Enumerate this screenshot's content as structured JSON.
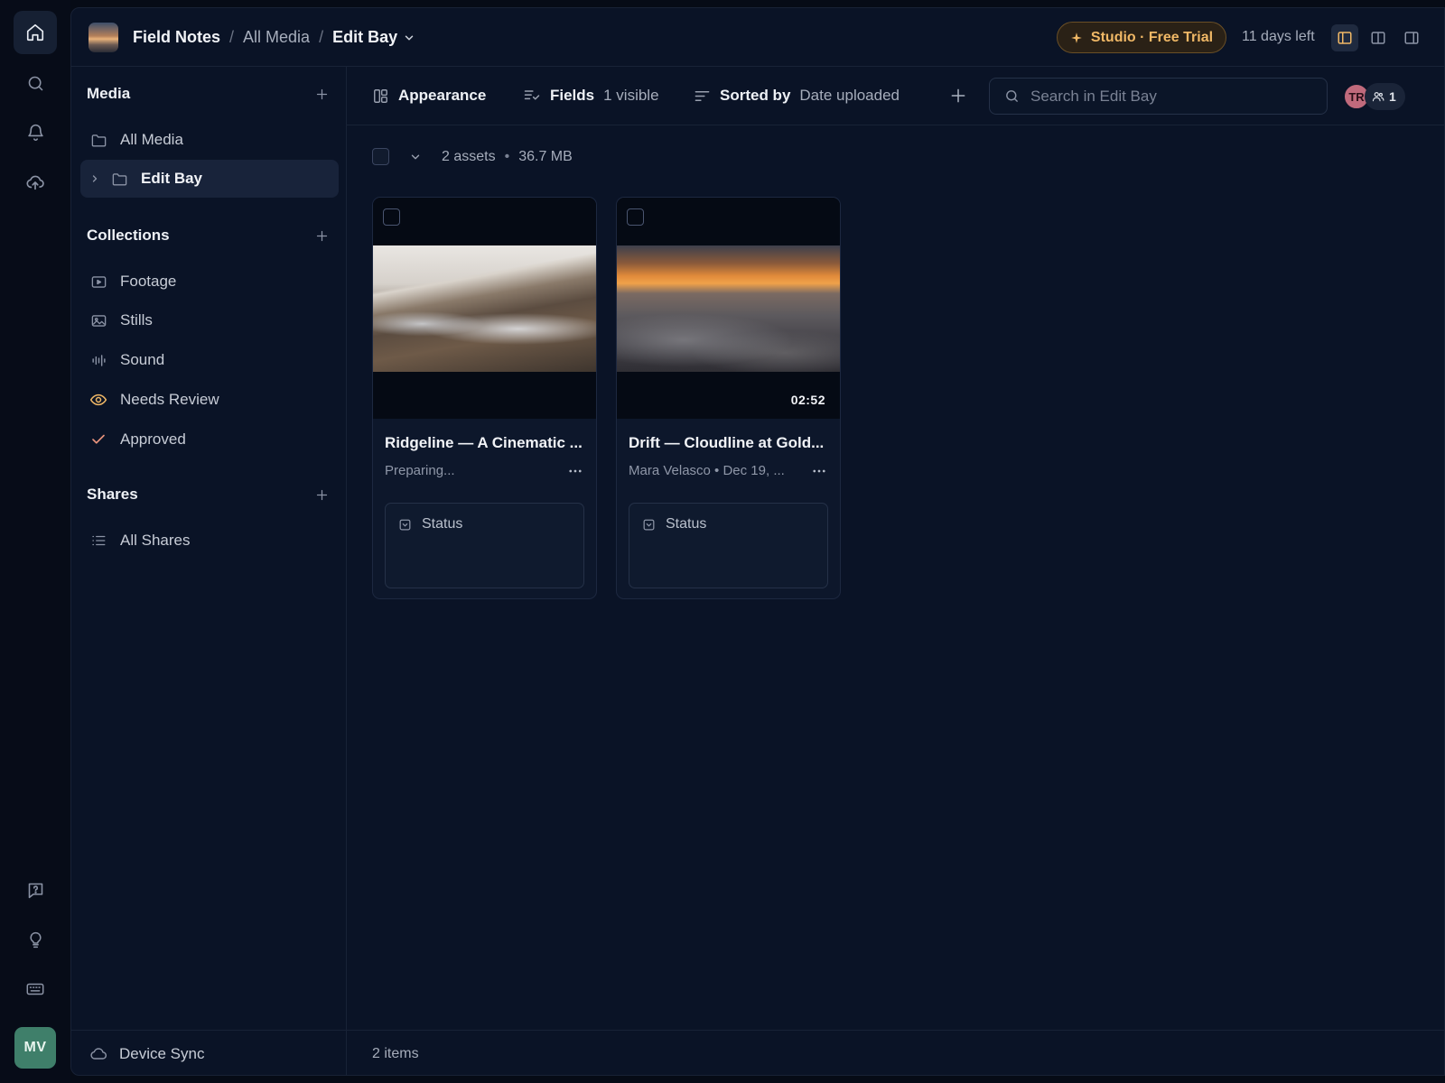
{
  "workspace": {
    "name": "Field Notes",
    "breadcrumb": [
      "All Media",
      "Edit Bay"
    ]
  },
  "trial": {
    "label": "Studio · Free Trial",
    "days_left": "11 days left"
  },
  "sidebar": {
    "media": {
      "title": "Media",
      "items": [
        {
          "label": "All Media",
          "icon": "folder-icon"
        },
        {
          "label": "Edit Bay",
          "icon": "folder-icon",
          "selected": true
        }
      ]
    },
    "collections": {
      "title": "Collections",
      "items": [
        {
          "label": "Footage",
          "icon": "video-icon"
        },
        {
          "label": "Stills",
          "icon": "image-icon"
        },
        {
          "label": "Sound",
          "icon": "waveform-icon"
        },
        {
          "label": "Needs Review",
          "icon": "eye-icon"
        },
        {
          "label": "Approved",
          "icon": "check-icon"
        }
      ]
    },
    "shares": {
      "title": "Shares",
      "items": [
        {
          "label": "All Shares",
          "icon": "list-icon"
        }
      ]
    },
    "device_sync": "Device Sync"
  },
  "toolbar": {
    "appearance": "Appearance",
    "fields_label": "Fields",
    "fields_value": "1 visible",
    "sort_label": "Sorted by",
    "sort_value": "Date uploaded",
    "search_placeholder": "Search in Edit Bay"
  },
  "presence": {
    "avatar_initials": "TR",
    "count": "1"
  },
  "assets": {
    "count": "2 assets",
    "size": "36.7 MB",
    "items": [
      {
        "title": "Ridgeline — A Cinematic ...",
        "meta": "Preparing...",
        "duration": "",
        "status_label": "Status"
      },
      {
        "title": "Drift — Cloudline at Gold...",
        "meta": "Mara Velasco • Dec 19, ...",
        "duration": "02:52",
        "status_label": "Status"
      }
    ]
  },
  "footer": {
    "items_count": "2 items"
  },
  "user": {
    "initials": "MV"
  },
  "colors": {
    "accent": "#f0b866",
    "background": "#0a1326",
    "avatar_user": "#3f7f6a",
    "avatar_presence": "#c06a7c"
  }
}
